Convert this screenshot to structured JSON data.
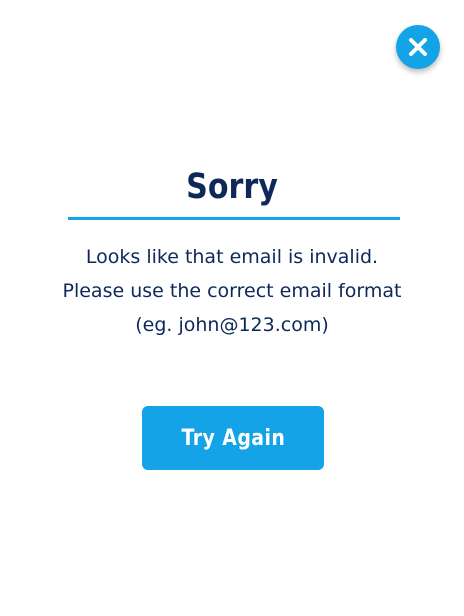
{
  "dialog": {
    "title": "Sorry",
    "message_lines": [
      "Looks like that email is invalid.",
      "Please use the correct email format",
      "(eg. john@123.com)"
    ],
    "primary_button_label": "Try Again",
    "close_icon": "close-icon"
  },
  "colors": {
    "accent": "#13a3e6",
    "title_text": "#0d2859",
    "background": "#ffffff",
    "button_text": "#ffffff"
  }
}
